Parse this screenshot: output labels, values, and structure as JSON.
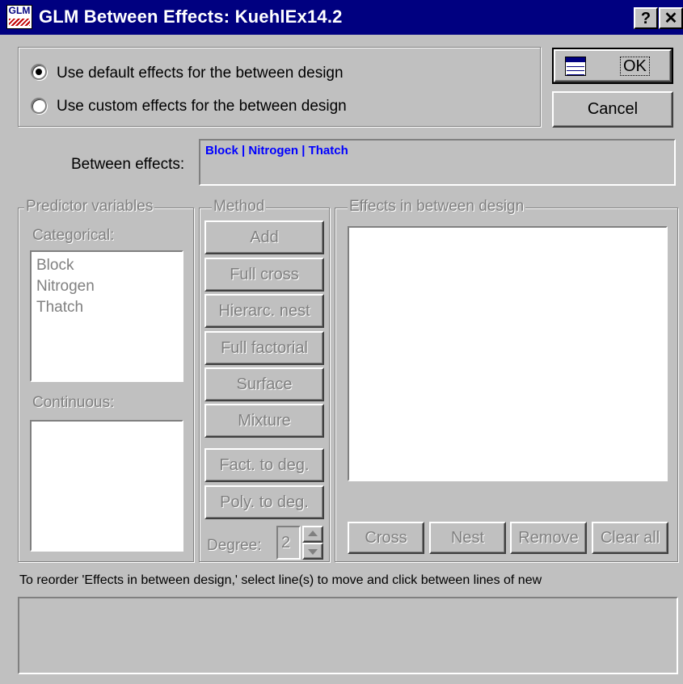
{
  "window": {
    "title": "GLM Between Effects: KuehlEx14.2",
    "icon_text": "GLM",
    "help_glyph": "?",
    "close_glyph": "✕"
  },
  "design_mode": {
    "options": [
      "Use default effects for the between design",
      "Use custom effects for the between design"
    ],
    "selected_index": 0
  },
  "buttons": {
    "ok": "OK",
    "cancel": "Cancel"
  },
  "between_effects": {
    "label": "Between effects:",
    "value": "Block | Nitrogen | Thatch",
    "value_color": "#0000ff"
  },
  "predictor_variables": {
    "title": "Predictor variables",
    "categorical_label": "Categorical:",
    "categorical": [
      "Block",
      "Nitrogen",
      "Thatch"
    ],
    "continuous_label": "Continuous:"
  },
  "method": {
    "title": "Method",
    "buttons": [
      "Add",
      "Full cross",
      "Hierarc. nest",
      "Full factorial",
      "Surface",
      "Mixture",
      "Fact. to deg.",
      "Poly. to deg."
    ],
    "degree_label": "Degree:",
    "degree_value": "2"
  },
  "effects_design": {
    "title": "Effects in between design",
    "buttons": [
      "Cross",
      "Nest",
      "Remove",
      "Clear all"
    ]
  },
  "hint": "To reorder 'Effects in between design,' select line(s) to move and click between lines of new"
}
